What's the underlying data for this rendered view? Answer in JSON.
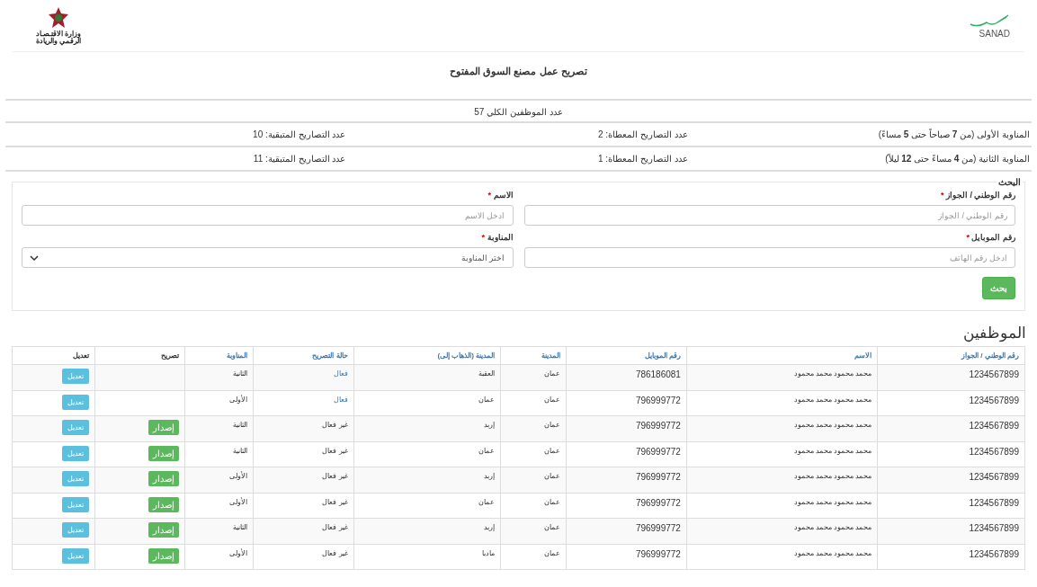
{
  "header": {
    "ministry_logo_text": "وزارة الاقتـصـاد الرقمي والريادة",
    "brand_logo_text": "SANAD"
  },
  "page_title": "تصريح عمل مصنع السوق المفتوح",
  "total_employees": "عدد الموظفين الكلي 57",
  "shifts": [
    {
      "name": "المناوبة الأولى (من **7** صباحاً حتى **5** مساءً)",
      "used": "عدد التصاريح المعطاة: 2",
      "remaining": "عدد التصاريح المتبقية: 10"
    },
    {
      "name": "المناوبة الثانية (من **4** مساءً حتى **12** ليلاً)",
      "used": "عدد التصاريح المعطاة: 1",
      "remaining": "عدد التصاريح المتبقية: 11"
    }
  ],
  "search": {
    "legend": "البحث",
    "fields": [
      {
        "kind": "input",
        "label": "رقم الوطني / الجواز",
        "required_mark": "*",
        "placeholder": "رقم الوطني / الجواز"
      },
      {
        "kind": "input",
        "label": "الاسم",
        "required_mark": "*",
        "placeholder": "ادخل الاسم"
      },
      {
        "kind": "input",
        "label": "رقم الموبايل",
        "required_mark": "*",
        "placeholder": "ادخل رقم الهاتف"
      },
      {
        "kind": "select",
        "label": "المناوبة",
        "required_mark": "*",
        "value": "اختر المناوبة"
      }
    ],
    "button": "بحث"
  },
  "employees": {
    "title": "الموظفين",
    "columns": [
      {
        "label": "رقم الوطني / الجواز",
        "sortable": true
      },
      {
        "label": "الاسم",
        "sortable": true
      },
      {
        "label": "رقم الموبايل",
        "sortable": true
      },
      {
        "label": "المدينة",
        "sortable": true
      },
      {
        "label": "المدينة (الذهاب إلى)",
        "sortable": true
      },
      {
        "label": "حالة التصريح",
        "sortable": true
      },
      {
        "label": "المناوبة",
        "sortable": true
      },
      {
        "label": "تصريح",
        "sortable": false
      },
      {
        "label": "تعديل",
        "sortable": false
      }
    ],
    "rows": [
      {
        "id": "1234567899",
        "name": "محمد محمود محمد محمود",
        "mobile": "786186081",
        "city": "عمان",
        "destination": "العقبة",
        "status": "فعال",
        "active": true,
        "shift": "الثانية",
        "issue_button": null,
        "edit_button": "تعديل"
      },
      {
        "id": "1234567899",
        "name": "محمد محمود محمد محمود",
        "mobile": "796999772",
        "city": "عمان",
        "destination": "عمان",
        "status": "فعال",
        "active": true,
        "shift": "الأولى",
        "issue_button": null,
        "edit_button": "تعديل"
      },
      {
        "id": "1234567899",
        "name": "محمد محمود محمد محمود",
        "mobile": "796999772",
        "city": "عمان",
        "destination": "إربد",
        "status": "غير فعال",
        "active": false,
        "shift": "الثانية",
        "issue_button": "إصدار",
        "edit_button": "تعديل"
      },
      {
        "id": "1234567899",
        "name": "محمد محمود محمد محمود",
        "mobile": "796999772",
        "city": "عمان",
        "destination": "عمان",
        "status": "غير فعال",
        "active": false,
        "shift": "الثانية",
        "issue_button": "إصدار",
        "edit_button": "تعديل"
      },
      {
        "id": "1234567899",
        "name": "محمد محمود محمد محمود",
        "mobile": "796999772",
        "city": "عمان",
        "destination": "إربد",
        "status": "غير فعال",
        "active": false,
        "shift": "الأولى",
        "issue_button": "إصدار",
        "edit_button": "تعديل"
      },
      {
        "id": "1234567899",
        "name": "محمد محمود محمد محمود",
        "mobile": "796999772",
        "city": "عمان",
        "destination": "عمان",
        "status": "غير فعال",
        "active": false,
        "shift": "الأولى",
        "issue_button": "إصدار",
        "edit_button": "تعديل"
      },
      {
        "id": "1234567899",
        "name": "محمد محمود محمد محمود",
        "mobile": "796999772",
        "city": "عمان",
        "destination": "إربد",
        "status": "غير فعال",
        "active": false,
        "shift": "الثانية",
        "issue_button": "إصدار",
        "edit_button": "تعديل"
      },
      {
        "id": "1234567899",
        "name": "محمد محمود محمد محمود",
        "mobile": "796999772",
        "city": "عمان",
        "destination": "مادبا",
        "status": "غير فعال",
        "active": false,
        "shift": "الأولى",
        "issue_button": "إصدار",
        "edit_button": "تعديل"
      }
    ]
  }
}
